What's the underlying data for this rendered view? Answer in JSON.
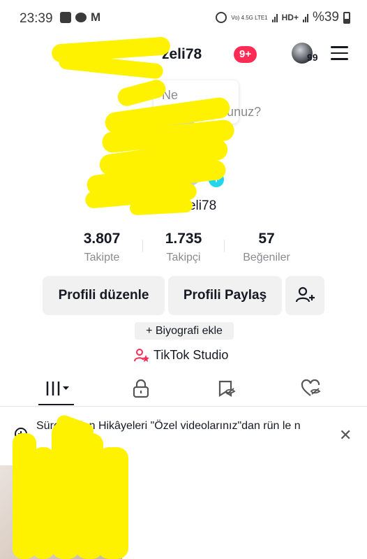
{
  "status_bar": {
    "time": "23:39",
    "network": "Vo) 4.5G LTE1",
    "battery": "%39"
  },
  "top_bar": {
    "username": "zeli78",
    "badge": "9+",
    "account_count": "99"
  },
  "tooltip": {
    "text": "Ne düşünüyorsunuz?"
  },
  "profile": {
    "handle": "@ka zeli78"
  },
  "stats": [
    {
      "value": "3.807",
      "label": "Takipte"
    },
    {
      "value": "1.735",
      "label": "Takipçi"
    },
    {
      "value": "57",
      "label": "Beğeniler"
    }
  ],
  "actions": {
    "edit_profile": "Profili düzenle",
    "share_profile": "Profili Paylaş",
    "add_bio": "+ Biyografi ekle",
    "studio": "TikTok Studio"
  },
  "tabs": [
    "videos-tab",
    "private-tab",
    "reposts-tab",
    "liked-tab"
  ],
  "notice": {
    "text": "Süresi d lan Hikâyeleri \"Özel videolarınız\"dan rün le n"
  },
  "colors": {
    "badge": "#fe2c55",
    "add_avatar": "#20d5ec",
    "redaction": "#fff200",
    "studio_icon": "#fe2c55"
  }
}
